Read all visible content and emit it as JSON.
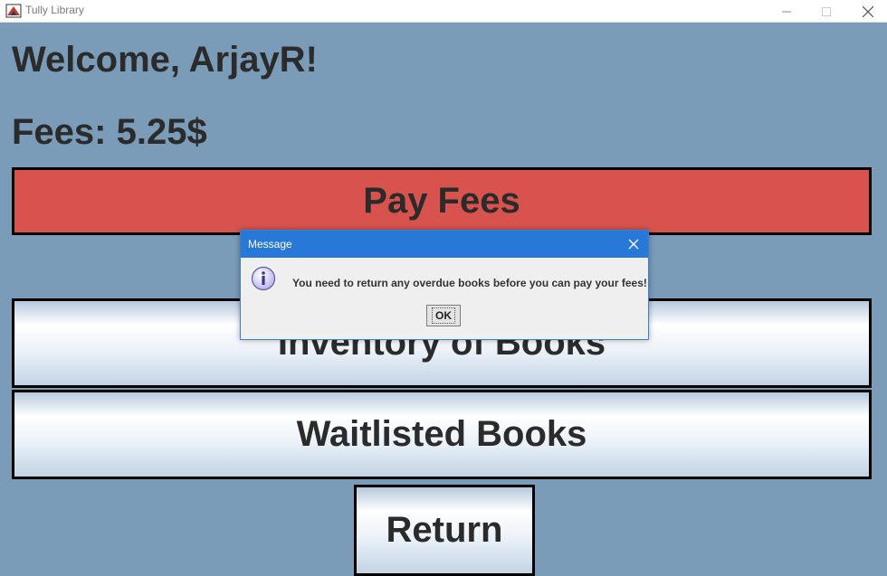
{
  "window": {
    "title": "Tully Library",
    "minimize": "—",
    "maximize": "☐",
    "close": "✕"
  },
  "main": {
    "welcome": "Welcome, ArjayR!",
    "fees": "Fees: 5.25$",
    "pay_fees_label": "Pay Fees",
    "inventory_label": "Inventory of Books",
    "waitlisted_label": "Waitlisted Books",
    "return_label": "Return"
  },
  "dialog": {
    "title": "Message",
    "message": "You need to return any overdue books before you can pay your fees!",
    "ok_label": "OK",
    "icon": "info-icon"
  },
  "colors": {
    "background": "#7a9cb8",
    "pay_button": "#d9534e",
    "dialog_title_bar": "#2778d7"
  }
}
